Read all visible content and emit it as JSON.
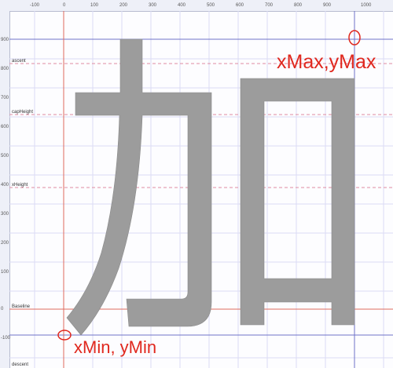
{
  "ruler": {
    "x_ticks": [
      "-100",
      "0",
      "100",
      "200",
      "300",
      "400",
      "500",
      "600",
      "700",
      "800",
      "900",
      "1000"
    ],
    "y_ticks": [
      "900",
      "800",
      "700",
      "600",
      "500",
      "400",
      "300",
      "200",
      "100",
      "0",
      "-100"
    ]
  },
  "metrics": {
    "ascent": "ascent",
    "cap_height": "capHeight",
    "x_height": "xHeight",
    "baseline": "Baseline",
    "descent": "descent"
  },
  "annotations": {
    "max_label": "xMax,yMax",
    "min_label": "xMin, yMin"
  },
  "glyph": {
    "character": "加"
  },
  "colors": {
    "glyph_fill": "#9c9c9c",
    "annotation": "#e0281e",
    "origin_line": "#e06a5c",
    "metric_line": "#e08ca0",
    "bounds_line": "#6e72c8",
    "grid": "#dcdcf4"
  }
}
